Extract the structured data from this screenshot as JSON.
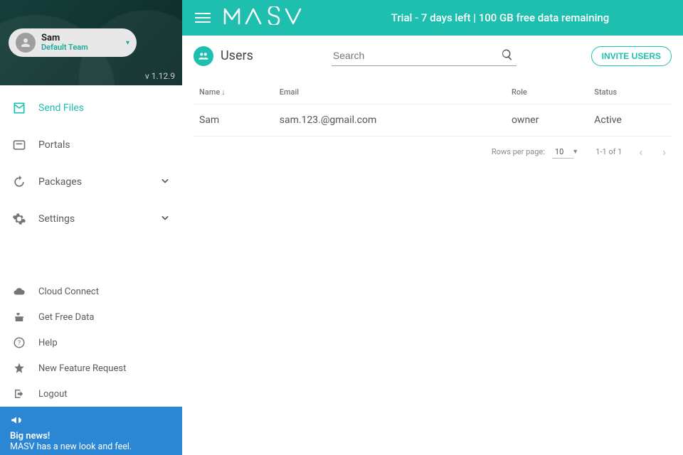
{
  "sidebar": {
    "user": {
      "name": "Sam",
      "team": "Default Team"
    },
    "version": "v 1.12.9",
    "primary": [
      {
        "label": "Send Files",
        "icon": "mail",
        "active": true,
        "expand": false
      },
      {
        "label": "Portals",
        "icon": "portal",
        "active": false,
        "expand": false
      },
      {
        "label": "Packages",
        "icon": "history",
        "active": false,
        "expand": true
      },
      {
        "label": "Settings",
        "icon": "gear",
        "active": false,
        "expand": true
      }
    ],
    "secondary": [
      {
        "label": "Cloud Connect",
        "icon": "cloud"
      },
      {
        "label": "Get Free Data",
        "icon": "gift"
      },
      {
        "label": "Help",
        "icon": "help"
      },
      {
        "label": "New Feature Request",
        "icon": "star"
      },
      {
        "label": "Logout",
        "icon": "logout"
      }
    ],
    "news": {
      "title": "Big news!",
      "body": "MASV has a new look and feel."
    }
  },
  "topbar": {
    "brand": "M A S V",
    "trial": "Trial - 7 days left | 100 GB free data remaining"
  },
  "page": {
    "title": "Users",
    "search_placeholder": "Search",
    "invite_label": "INVITE USERS",
    "columns": [
      "Name",
      "Email",
      "Role",
      "Status"
    ],
    "rows": [
      {
        "name": "Sam",
        "email": "sam.123.@gmail.com",
        "role": "owner",
        "status": "Active"
      }
    ],
    "footer": {
      "rows_per_page_label": "Rows per page:",
      "rows_per_page_value": "10",
      "range": "1-1 of 1"
    }
  }
}
